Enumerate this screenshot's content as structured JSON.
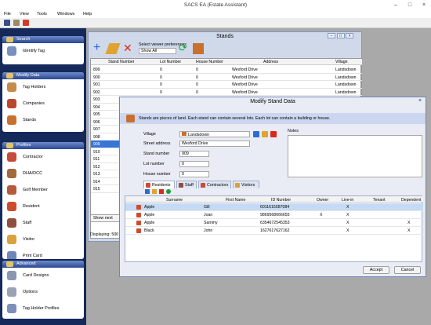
{
  "app": {
    "title": "SACS EA (Estate Assistant)"
  },
  "menu": [
    "File",
    "View",
    "Tools",
    "Windows",
    "Help"
  ],
  "sidebar": {
    "search": {
      "title": "Search",
      "items": [
        "Identify Tag"
      ]
    },
    "modify": {
      "title": "Modify Data",
      "items": [
        "Tag Holders",
        "Companies",
        "Stands"
      ]
    },
    "profiles": {
      "title": "Profiles",
      "items": [
        "Contractor",
        "DHA/DCC",
        "Golf Member",
        "Resident",
        "Staff",
        "Visitor",
        "Print Card"
      ]
    },
    "advanced": {
      "title": "Advanced",
      "items": [
        "Card Designs",
        "Options",
        "Tag Holder Profiles"
      ]
    }
  },
  "stands": {
    "title": "Stands",
    "viewer_label": "Select viewer preferences",
    "viewer_value": "Show All",
    "columns": [
      "Stand Number",
      "Lot Number",
      "House Number",
      "Address",
      "Village"
    ],
    "rows": [
      [
        "899",
        "0",
        "0",
        "Wexford Drive",
        "Landsdown"
      ],
      [
        "900",
        "0",
        "0",
        "Wexford Drive",
        "Landsdown"
      ],
      [
        "901",
        "0",
        "0",
        "Wexford Drive",
        "Landsdown"
      ],
      [
        "902",
        "0",
        "0",
        "Wexford Drive",
        "Landsdown"
      ],
      [
        "903",
        "",
        "",
        "",
        ""
      ],
      [
        "904",
        "",
        "",
        "",
        ""
      ],
      [
        "905",
        "",
        "",
        "",
        ""
      ],
      [
        "906",
        "",
        "",
        "",
        ""
      ],
      [
        "907",
        "",
        "",
        "",
        ""
      ],
      [
        "908",
        "",
        "",
        "",
        ""
      ],
      [
        "909",
        "",
        "",
        "",
        ""
      ],
      [
        "910",
        "",
        "",
        "",
        ""
      ],
      [
        "911",
        "",
        "",
        "",
        ""
      ],
      [
        "912",
        "",
        "",
        "",
        ""
      ],
      [
        "913",
        "",
        "",
        "",
        ""
      ],
      [
        "914",
        "",
        "",
        "",
        ""
      ],
      [
        "915",
        "",
        "",
        "",
        ""
      ]
    ],
    "selected_index": 10,
    "show_next": "Show next 500",
    "displaying": "Displaying: 500"
  },
  "modal": {
    "title": "Modify Stand Data",
    "info": "Stands are pieces of land. Each stand can contain several lots. Each lot can contain a building or house.",
    "village_label": "Village",
    "village_value": "Landsdown",
    "street_label": "Street address",
    "street_value": "Wexford Drive",
    "stand_label": "Stand number",
    "stand_value": "909",
    "lot_label": "Lot number",
    "lot_value": "0",
    "house_label": "House number",
    "house_value": "0",
    "notes_label": "Notes",
    "tabs": [
      "Residents",
      "Staff",
      "Contractors",
      "Visitors"
    ],
    "columns": [
      "Surname",
      "First Name",
      "ID Number",
      "Owner",
      "Live-in",
      "Tenant",
      "Dependent"
    ],
    "rows": [
      [
        "Apple",
        "Gill",
        "6011615087084",
        "",
        "X",
        "",
        ""
      ],
      [
        "Apple",
        "Joan",
        "9869568666655",
        "X",
        "X",
        "",
        ""
      ],
      [
        "Apple",
        "Sammy",
        "6354672545353",
        "",
        "X",
        "",
        "X"
      ],
      [
        "Black",
        "John",
        "1627617627162",
        "",
        "X",
        "",
        "X"
      ]
    ],
    "accept": "Accept",
    "cancel": "Cancel"
  }
}
